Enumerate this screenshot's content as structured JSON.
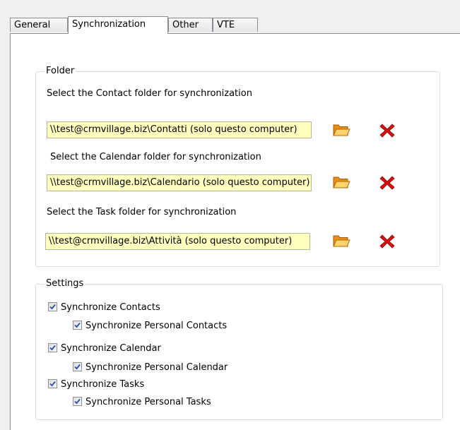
{
  "tabs": [
    {
      "label": "General"
    },
    {
      "label": "Synchronization"
    },
    {
      "label": "Other"
    },
    {
      "label": "VTE"
    }
  ],
  "active_tab": "Synchronization",
  "folder_group": {
    "title": "Folder",
    "contact": {
      "label": "Select the Contact folder for synchronization",
      "value": "\\\\test@crmvillage.biz\\Contatti (solo questo computer)"
    },
    "calendar": {
      "label": "Select the Calendar folder for synchronization",
      "value": "\\\\test@crmvillage.biz\\Calendario (solo questo computer)"
    },
    "task": {
      "label": "Select the Task folder for synchronization",
      "value": "\\\\test@crmvillage.biz\\Attività (solo questo computer)"
    }
  },
  "settings_group": {
    "title": "Settings",
    "items": [
      {
        "label": "Synchronize Contacts",
        "checked": true
      },
      {
        "label": "Synchronize Personal Contacts",
        "checked": true
      },
      {
        "label": "Synchronize Calendar",
        "checked": true
      },
      {
        "label": "Synchronize Personal Calendar",
        "checked": true
      },
      {
        "label": "Synchronize Tasks",
        "checked": true
      },
      {
        "label": "Synchronize Personal Tasks",
        "checked": true
      }
    ]
  },
  "icons": {
    "browse": "open-folder-icon",
    "clear": "red-x-delete-icon"
  },
  "colors": {
    "path_field_bg": "#ffffc0",
    "delete_red": "#d41111",
    "folder_orange": "#f5a623"
  }
}
